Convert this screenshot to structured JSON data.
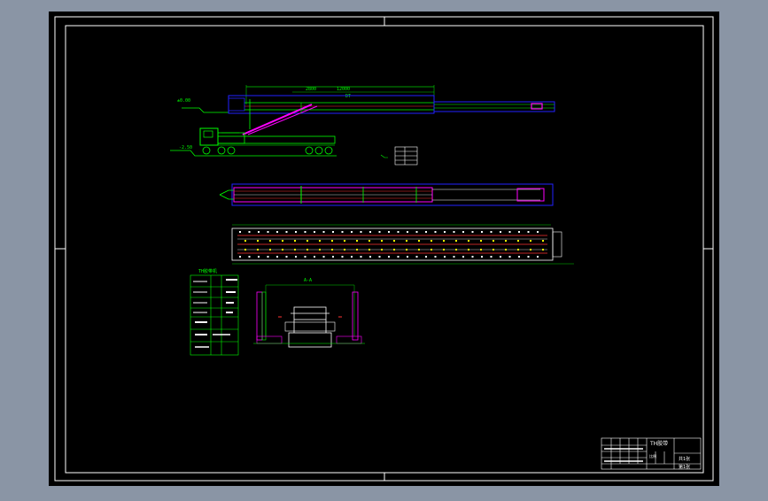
{
  "viewer": {
    "background_color": "#8a95a5",
    "sheet_color": "#000000",
    "line_colors": {
      "frame": "#ffffff",
      "structure": "#00ff00",
      "dimension": "#00cc00",
      "belt": "#ff00ff",
      "outline": "#2222ff",
      "centerline": "#ff3333",
      "accent": "#00ffff",
      "marker": "#ffff00"
    }
  },
  "drawing": {
    "title": "TH胶带",
    "scale_label": "比例",
    "sheet_label": "第1张",
    "sheet_total_label": "共1张"
  }
}
